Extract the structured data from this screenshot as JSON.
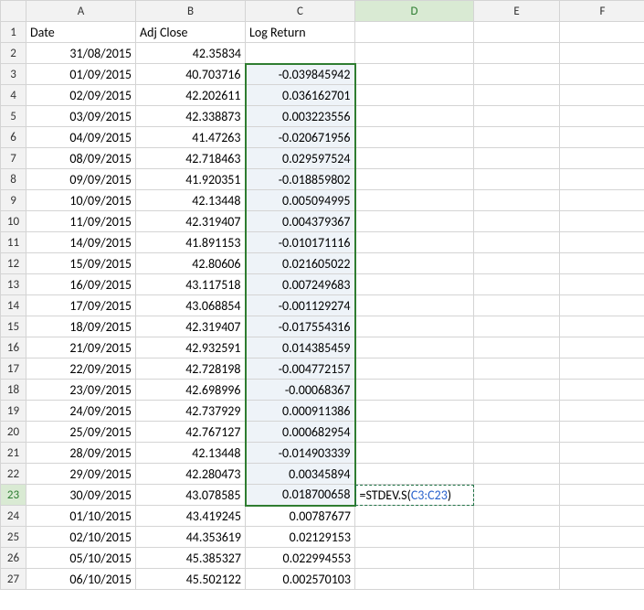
{
  "columns": [
    "A",
    "B",
    "C",
    "D",
    "E",
    "F"
  ],
  "headers": {
    "A": "Date",
    "B": "Adj Close",
    "C": "Log Return"
  },
  "rows": [
    {
      "n": 1,
      "A": "Date",
      "B": "Adj Close",
      "C": "Log Return",
      "text": true
    },
    {
      "n": 2,
      "A": "31/08/2015",
      "B": "42.35834",
      "C": ""
    },
    {
      "n": 3,
      "A": "01/09/2015",
      "B": "40.703716",
      "C": "-0.039845942"
    },
    {
      "n": 4,
      "A": "02/09/2015",
      "B": "42.202611",
      "C": "0.036162701"
    },
    {
      "n": 5,
      "A": "03/09/2015",
      "B": "42.338873",
      "C": "0.003223556"
    },
    {
      "n": 6,
      "A": "04/09/2015",
      "B": "41.47263",
      "C": "-0.020671956"
    },
    {
      "n": 7,
      "A": "08/09/2015",
      "B": "42.718463",
      "C": "0.029597524"
    },
    {
      "n": 8,
      "A": "09/09/2015",
      "B": "41.920351",
      "C": "-0.018859802"
    },
    {
      "n": 9,
      "A": "10/09/2015",
      "B": "42.13448",
      "C": "0.005094995"
    },
    {
      "n": 10,
      "A": "11/09/2015",
      "B": "42.319407",
      "C": "0.004379367"
    },
    {
      "n": 11,
      "A": "14/09/2015",
      "B": "41.891153",
      "C": "-0.010171116"
    },
    {
      "n": 12,
      "A": "15/09/2015",
      "B": "42.80606",
      "C": "0.021605022"
    },
    {
      "n": 13,
      "A": "16/09/2015",
      "B": "43.117518",
      "C": "0.007249683"
    },
    {
      "n": 14,
      "A": "17/09/2015",
      "B": "43.068854",
      "C": "-0.001129274"
    },
    {
      "n": 15,
      "A": "18/09/2015",
      "B": "42.319407",
      "C": "-0.017554316"
    },
    {
      "n": 16,
      "A": "21/09/2015",
      "B": "42.932591",
      "C": "0.014385459"
    },
    {
      "n": 17,
      "A": "22/09/2015",
      "B": "42.728198",
      "C": "-0.004772157"
    },
    {
      "n": 18,
      "A": "23/09/2015",
      "B": "42.698996",
      "C": "-0.00068367"
    },
    {
      "n": 19,
      "A": "24/09/2015",
      "B": "42.737929",
      "C": "0.000911386"
    },
    {
      "n": 20,
      "A": "25/09/2015",
      "B": "42.767127",
      "C": "0.000682954"
    },
    {
      "n": 21,
      "A": "28/09/2015",
      "B": "42.13448",
      "C": "-0.014903339"
    },
    {
      "n": 22,
      "A": "29/09/2015",
      "B": "42.280473",
      "C": "0.00345894"
    },
    {
      "n": 23,
      "A": "30/09/2015",
      "B": "43.078585",
      "C": "0.018700658",
      "D_formula": true
    },
    {
      "n": 24,
      "A": "01/10/2015",
      "B": "43.419245",
      "C": "0.00787677"
    },
    {
      "n": 25,
      "A": "02/10/2015",
      "B": "44.353619",
      "C": "0.02129153"
    },
    {
      "n": 26,
      "A": "05/10/2015",
      "B": "45.385327",
      "C": "0.022994553"
    },
    {
      "n": 27,
      "A": "06/10/2015",
      "B": "45.502122",
      "C": "0.002570103"
    }
  ],
  "formula": {
    "prefix": "=STDEV.S(",
    "ref": "C3:C23",
    "suffix": ")"
  },
  "selected_range": {
    "col": "C",
    "start": 3,
    "end": 23
  },
  "active_cell": {
    "col": "D",
    "row": 23
  },
  "chart_data": {
    "type": "table",
    "title": "",
    "columns": [
      "Date",
      "Adj Close",
      "Log Return"
    ],
    "data": [
      [
        "31/08/2015",
        42.35834,
        null
      ],
      [
        "01/09/2015",
        40.703716,
        -0.039845942
      ],
      [
        "02/09/2015",
        42.202611,
        0.036162701
      ],
      [
        "03/09/2015",
        42.338873,
        0.003223556
      ],
      [
        "04/09/2015",
        41.47263,
        -0.020671956
      ],
      [
        "08/09/2015",
        42.718463,
        0.029597524
      ],
      [
        "09/09/2015",
        41.920351,
        -0.018859802
      ],
      [
        "10/09/2015",
        42.13448,
        0.005094995
      ],
      [
        "11/09/2015",
        42.319407,
        0.004379367
      ],
      [
        "14/09/2015",
        41.891153,
        -0.010171116
      ],
      [
        "15/09/2015",
        42.80606,
        0.021605022
      ],
      [
        "16/09/2015",
        43.117518,
        0.007249683
      ],
      [
        "17/09/2015",
        43.068854,
        -0.001129274
      ],
      [
        "18/09/2015",
        42.319407,
        -0.017554316
      ],
      [
        "21/09/2015",
        42.932591,
        0.014385459
      ],
      [
        "22/09/2015",
        42.728198,
        -0.004772157
      ],
      [
        "23/09/2015",
        42.698996,
        -0.00068367
      ],
      [
        "24/09/2015",
        42.737929,
        0.000911386
      ],
      [
        "25/09/2015",
        42.767127,
        0.000682954
      ],
      [
        "28/09/2015",
        42.13448,
        -0.014903339
      ],
      [
        "29/09/2015",
        42.280473,
        0.00345894
      ],
      [
        "30/09/2015",
        43.078585,
        0.018700658
      ],
      [
        "01/10/2015",
        43.419245,
        0.00787677
      ],
      [
        "02/10/2015",
        44.353619,
        0.02129153
      ],
      [
        "05/10/2015",
        45.385327,
        0.022994553
      ],
      [
        "06/10/2015",
        45.502122,
        0.002570103
      ]
    ],
    "formula_in_D23": "=STDEV.S(C3:C23)"
  }
}
